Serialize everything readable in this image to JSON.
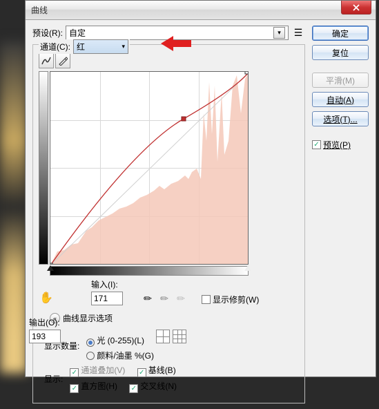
{
  "window": {
    "title": "曲线"
  },
  "preset": {
    "label": "预设(R):",
    "value": "自定"
  },
  "channel": {
    "label": "通道(C):",
    "value": "红"
  },
  "output": {
    "label": "输出(O):",
    "value": "193"
  },
  "input": {
    "label": "输入(I):",
    "value": "171"
  },
  "show_clip": {
    "label": "显示修剪(W)"
  },
  "display_options": {
    "label": "曲线显示选项"
  },
  "show_amount": {
    "label": "显示数量:",
    "opt1": "光 (0-255)(L)",
    "opt2": "颜料/油墨 %(G)"
  },
  "show": {
    "label": "显示:",
    "chk1": "通道叠加(V)",
    "chk2": "基线(B)",
    "chk3": "直方图(H)",
    "chk4": "交叉线(N)"
  },
  "buttons": {
    "ok": "确定",
    "cancel": "复位",
    "smooth": "平滑(M)",
    "auto": "自动(A)",
    "options": "选项(T)..."
  },
  "preview": {
    "label": "预览(P)"
  },
  "chart_data": {
    "type": "line",
    "title": "",
    "xlabel": "输入",
    "ylabel": "输出",
    "xlim": [
      0,
      255
    ],
    "ylim": [
      0,
      255
    ],
    "series": [
      {
        "name": "baseline",
        "x": [
          0,
          255
        ],
        "y": [
          0,
          255
        ]
      },
      {
        "name": "curve",
        "x": [
          0,
          171,
          255
        ],
        "y": [
          0,
          193,
          255
        ]
      }
    ],
    "points": [
      {
        "x": 0,
        "y": 0
      },
      {
        "x": 171,
        "y": 193
      },
      {
        "x": 255,
        "y": 255
      }
    ],
    "histogram_channel": "red"
  }
}
